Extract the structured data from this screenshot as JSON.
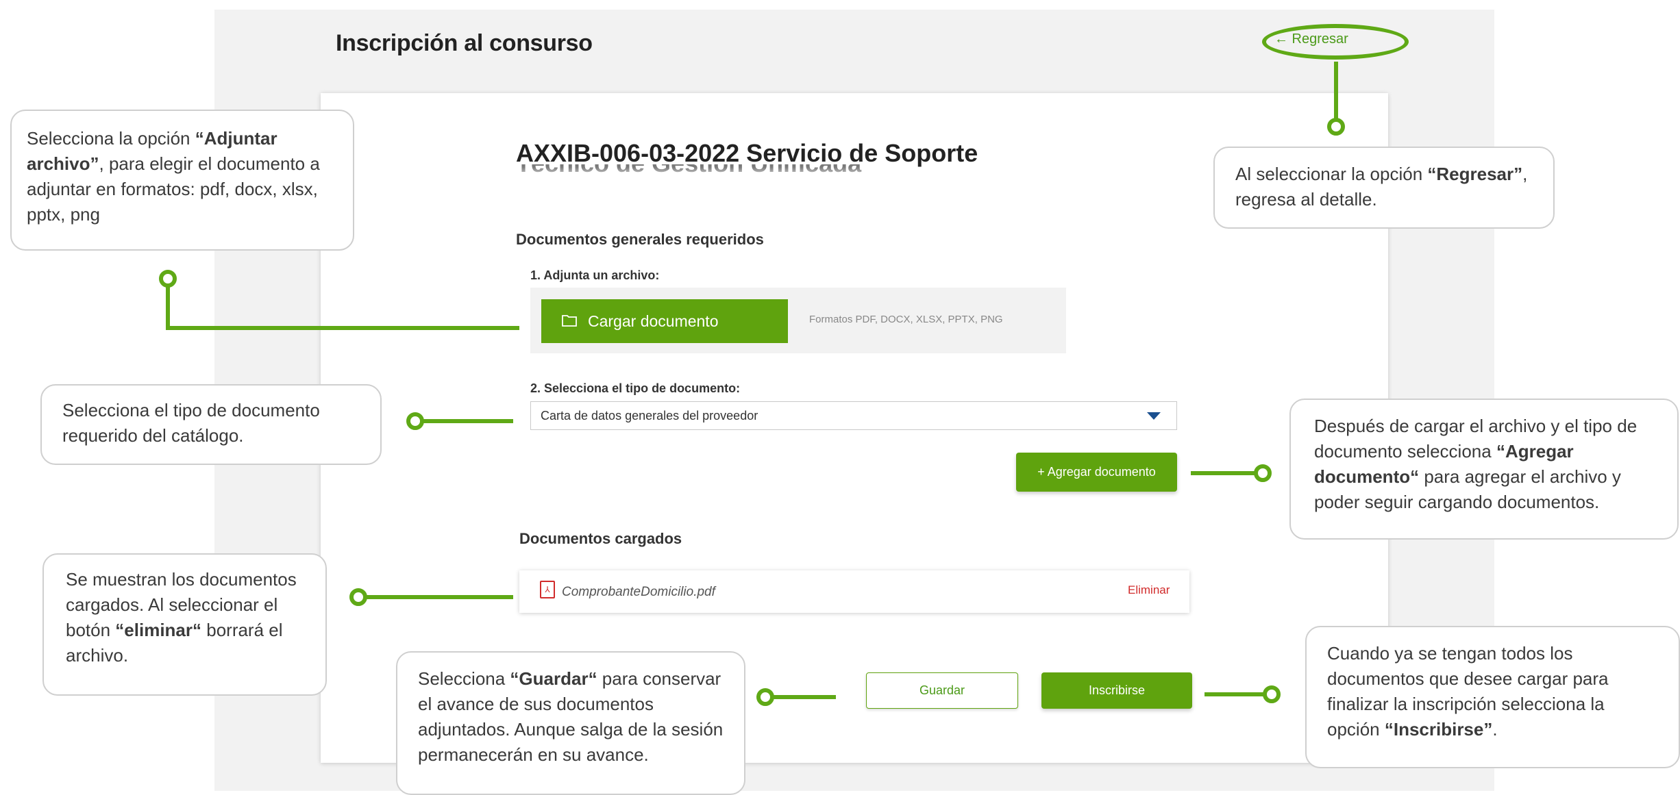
{
  "page": {
    "title": "Inscripción al consurso",
    "back_label": "← Regresar"
  },
  "contest": {
    "title": "AXXIB-006-03-2022 Servicio de Soporte",
    "title_cut": "Técnico de Gestión Unificada"
  },
  "general_docs": {
    "section_title": "Documentos generales requeridos",
    "step1_label": "1. Adjunta un archivo:",
    "upload_button": "Cargar documento",
    "formats_text": "Formatos PDF, DOCX, XLSX, PPTX, PNG",
    "step2_label": "2. Selecciona el tipo de documento:",
    "selected_type": "Carta de datos generales del proveedor",
    "add_button": "+ Agregar documento"
  },
  "uploaded": {
    "section_title": "Documentos cargados",
    "files": [
      {
        "name": "ComprobanteDomicilio.pdf",
        "delete_label": "Eliminar"
      }
    ]
  },
  "actions": {
    "save_label": "Guardar",
    "enroll_label": "Inscribirse"
  },
  "callouts": {
    "attach": {
      "pre": "Selecciona la opción ",
      "bold": "“Adjuntar archivo”",
      "post": ", para elegir el documento a adjuntar en formatos: pdf, docx, xlsx, pptx,  png"
    },
    "type": {
      "text": "Selecciona el tipo de documento requerido del catálogo."
    },
    "uploaded": {
      "pre": "Se muestran los documentos cargados. Al seleccionar el botón ",
      "bold": "“eliminar“",
      "post": " borrará el archivo."
    },
    "save": {
      "pre": "Selecciona ",
      "bold": "“Guardar“",
      "post": " para conservar el avance de sus documentos adjuntados. Aunque salga de la sesión permanecerán en su avance."
    },
    "back": {
      "pre": "Al seleccionar la opción ",
      "bold": "“Regresar”",
      "post": ", regresa al detalle."
    },
    "add": {
      "pre": "Después de cargar el archivo y el tipo de documento selecciona ",
      "bold": "“Agregar documento“",
      "post": " para agregar el archivo y poder seguir cargando documentos."
    },
    "enroll": {
      "pre": "Cuando ya se tengan todos los documentos que desee cargar para finalizar la inscripción selecciona la opción ",
      "bold": "“Inscribirse”",
      "post": "."
    }
  },
  "colors": {
    "accent_green": "#5fa30e",
    "delete_red": "#d12b2b",
    "caret_blue": "#1a4f8f"
  }
}
